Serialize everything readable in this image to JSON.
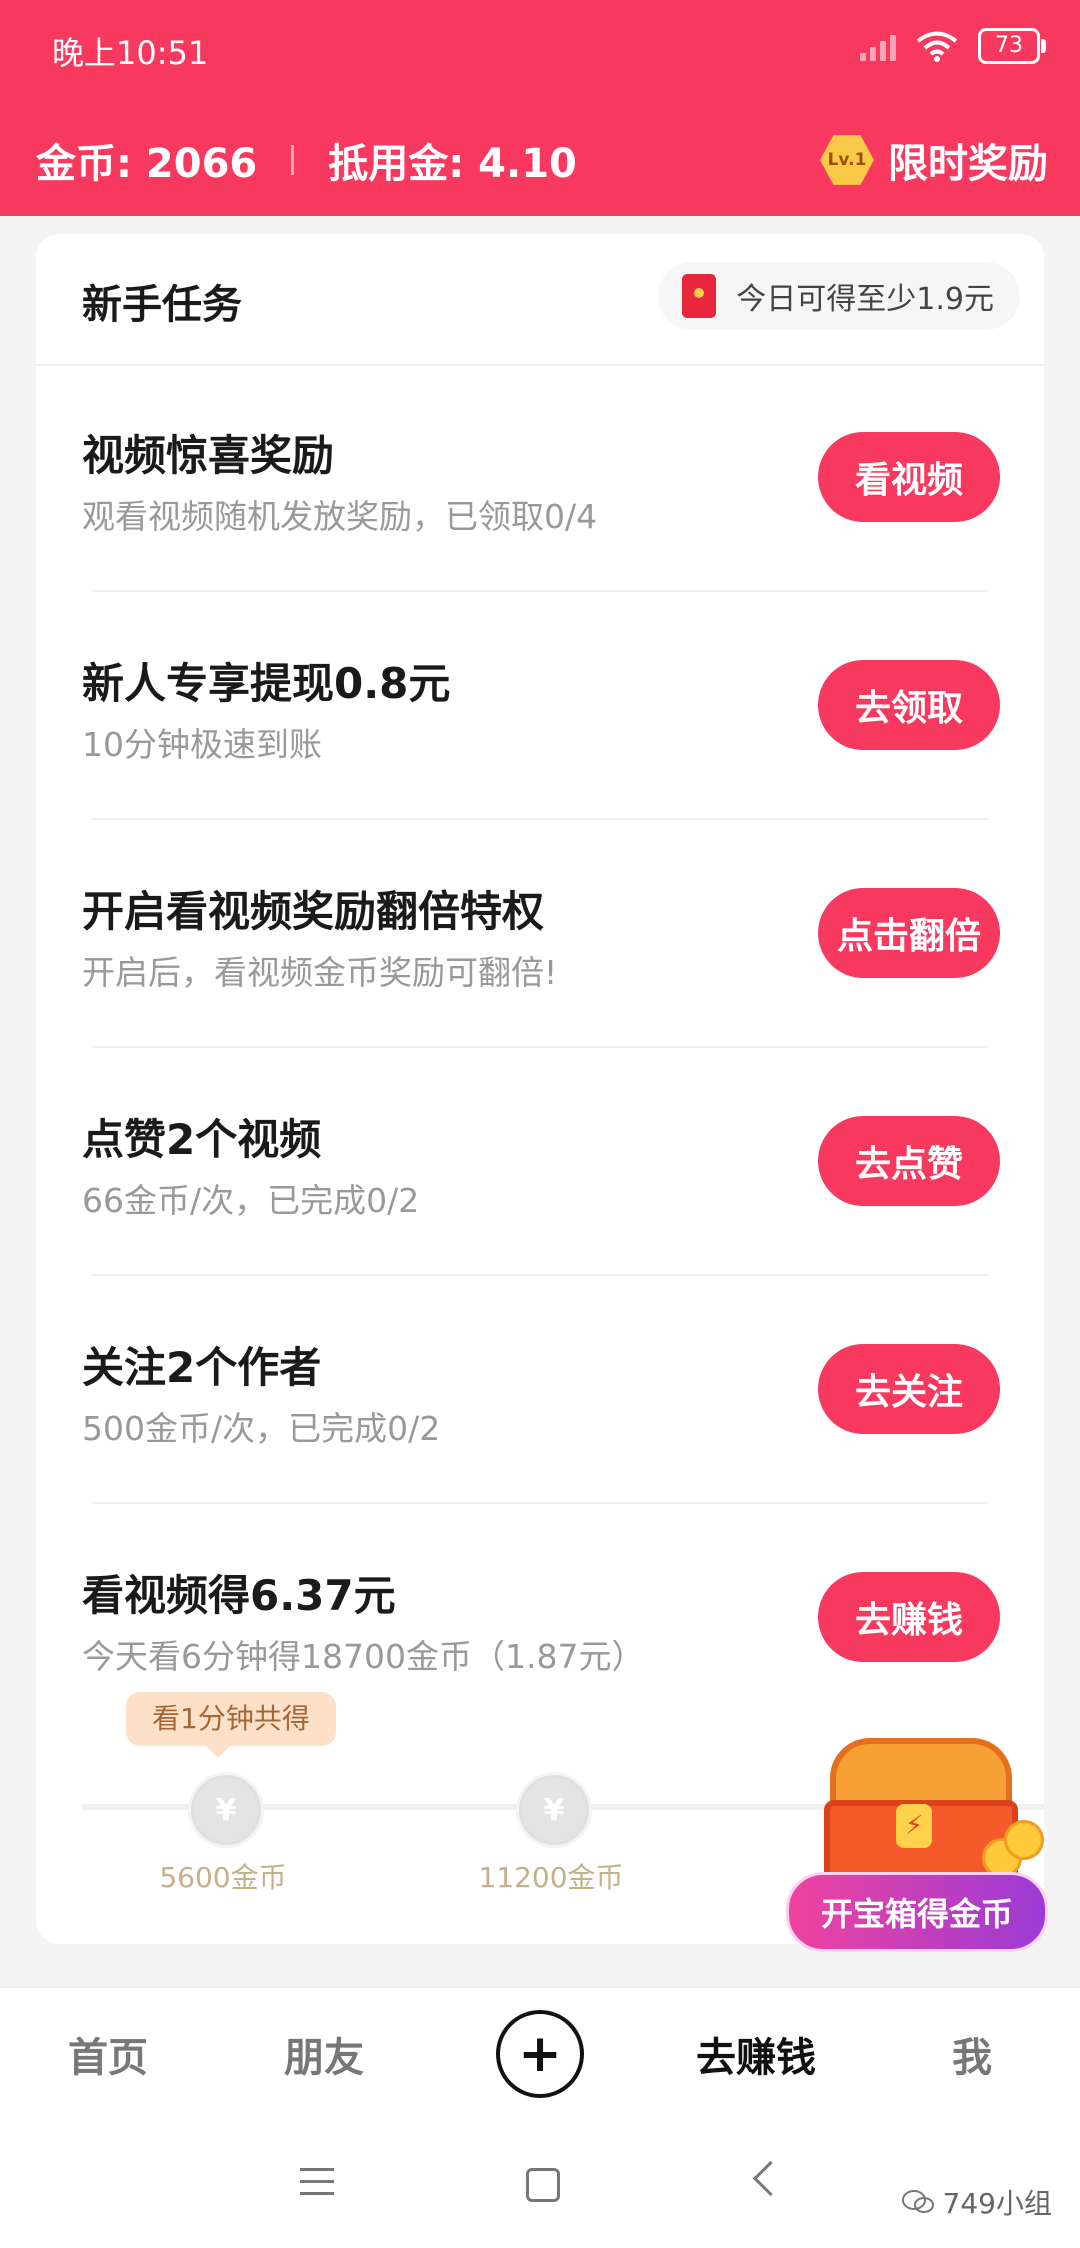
{
  "status": {
    "time": "晚上10:51",
    "battery": "73"
  },
  "header": {
    "coins": "金币: 2066",
    "deduct": "抵用金: 4.10",
    "level": "Lv.1",
    "limited_reward": "限时奖励"
  },
  "card": {
    "title": "新手任务",
    "today_hint": "今日可得至少1.9元"
  },
  "tasks": [
    {
      "title": "视频惊喜奖励",
      "sub": "观看视频随机发放奖励，已领取0/4",
      "button": "看视频"
    },
    {
      "title": "新人专享提现0.8元",
      "sub": "10分钟极速到账",
      "button": "去领取"
    },
    {
      "title": "开启看视频奖励翻倍特权",
      "sub": "开启后，看视频金币奖励可翻倍!",
      "button": "点击翻倍"
    },
    {
      "title": "点赞2个视频",
      "sub": "66金币/次，已完成0/2",
      "button": "去点赞"
    },
    {
      "title": "关注2个作者",
      "sub": "500金币/次，已完成0/2",
      "button": "去关注"
    },
    {
      "title": "看视频得6.37元",
      "sub": "今天看6分钟得18700金币（1.87元）",
      "button": "去赚钱"
    }
  ],
  "progress": {
    "tip": "看1分钟共得",
    "currency_symbol": "¥",
    "nodes": [
      {
        "label": "5600金币"
      },
      {
        "label": "11200金币"
      }
    ]
  },
  "treasure": {
    "label": "开宝箱得金币",
    "bolt": "⚡"
  },
  "nav": {
    "home": "首页",
    "friends": "朋友",
    "plus": "+",
    "earn": "去赚钱",
    "me": "我"
  },
  "watermark": "749小组",
  "colors": {
    "brand": "#f7385f",
    "treasure_gradient_start": "#f0439e",
    "treasure_gradient_end": "#9a3bd6"
  }
}
